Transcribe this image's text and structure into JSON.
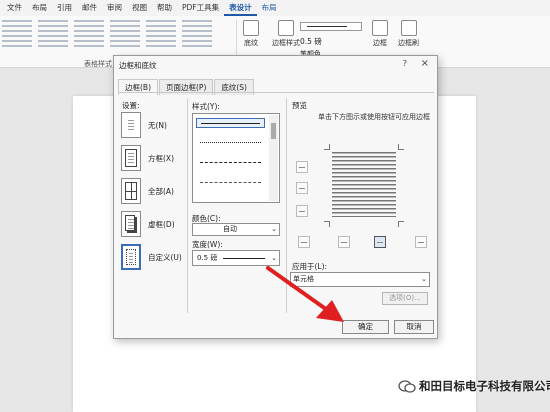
{
  "menubar": {
    "items": [
      "文件",
      "布局",
      "引用",
      "邮件",
      "审阅",
      "视图",
      "帮助",
      "PDF工具集"
    ],
    "active_tab": "表设计",
    "context_tab": "布局"
  },
  "ribbon": {
    "table_styles_group": "表格样式",
    "shading": "底纹",
    "border_styles": "边框样式",
    "pen_weight": "0.5 磅",
    "pen_color": "笔颜色",
    "borders": "边框",
    "border_painter": "边框刷"
  },
  "dialog": {
    "title": "边框和底纹",
    "help": "?",
    "close": "×",
    "tabs": [
      "边框(B)",
      "页面边框(P)",
      "底纹(S)"
    ],
    "settings_label": "设置:",
    "settings": [
      "无(N)",
      "方框(X)",
      "全部(A)",
      "虚框(D)",
      "自定义(U)"
    ],
    "style_label": "样式(Y):",
    "color_label": "颜色(C):",
    "color_value": "自动",
    "width_label": "宽度(W):",
    "width_value": "0.5 磅",
    "preview_label": "预览",
    "preview_hint": "单击下方图示或使用按钮可应用边框",
    "apply_label": "应用于(L):",
    "apply_value": "单元格",
    "options_button": "选项(O)...",
    "ok_button": "确定",
    "cancel_button": "取消"
  },
  "watermark": "和田目标电子科技有限公司"
}
